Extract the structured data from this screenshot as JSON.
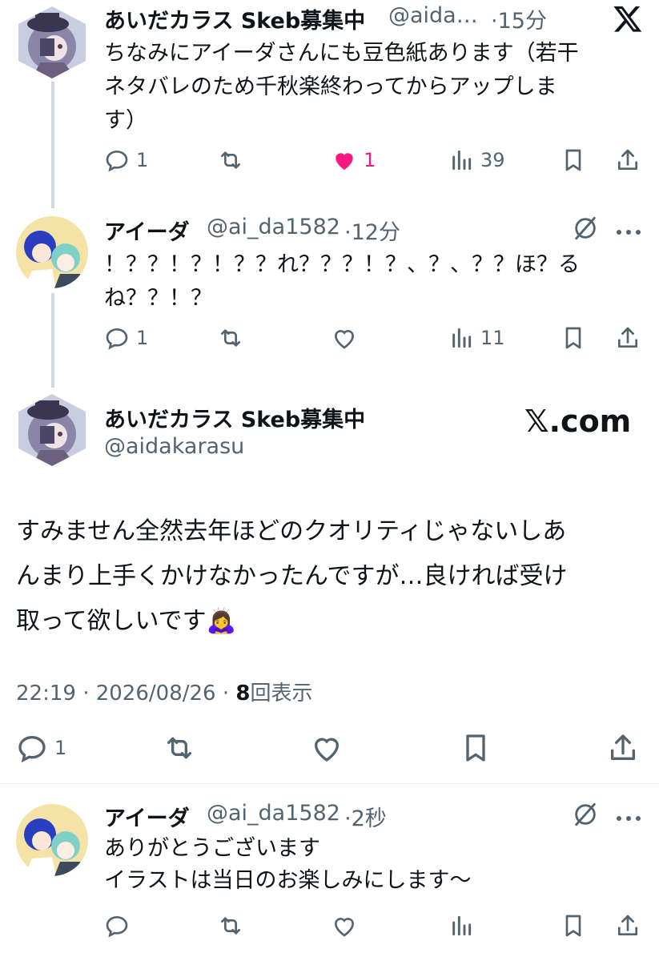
{
  "colors": {
    "text": "#0f1419",
    "muted": "#536471",
    "like_active": "#f91880",
    "thread_line": "#cfd9de",
    "divider": "#e6ecf0"
  },
  "tweets": [
    {
      "name": "あいだカラス Skeb募集中",
      "handle": "@aida…",
      "time": "·15分",
      "lines": [
        "ちなみにアイーダさんにも豆色紙あります（若干",
        "ネタバレのため千秋楽終わってからアップしま",
        "す）"
      ],
      "replies": "1",
      "retweets": "",
      "likes": "1",
      "liked": true,
      "views": "39",
      "header_icon": "x-logo-icon"
    },
    {
      "name": "アイーダ",
      "handle": "@ai_da1582",
      "time": "·12分",
      "lines": [
        "！？？！？！？？れ？？？！？、？、？？ほ？る",
        "ね？？！？"
      ],
      "replies": "1",
      "retweets": "",
      "likes": "",
      "liked": false,
      "views": "11",
      "header_icon": "grok-icon"
    }
  ],
  "main_tweet": {
    "name": "あいだカラス Skeb募集中",
    "handle": "@aidakarasu",
    "brand": "𝕏.com",
    "lines": [
      "すみません全然去年ほどのクオリティじゃないしあ",
      "んまり上手くかけなかったんですが…良ければ受け",
      "取って欲しいです"
    ],
    "emoji": "🙇‍♀️",
    "time": "22:19 · 2026/08/26 · ",
    "views_count": "8",
    "views_label": "回表示",
    "replies": "1"
  },
  "reply": {
    "name": "アイーダ",
    "handle": "@ai_da1582",
    "time": "·2秒",
    "lines": [
      "ありがとうございます",
      "イラストは当日のお楽しみにします〜"
    ],
    "header_icon": "grok-icon"
  },
  "icons": [
    "reply-icon",
    "retweet-icon",
    "like-icon",
    "views-icon",
    "bookmark-icon",
    "share-icon",
    "more-icon"
  ]
}
